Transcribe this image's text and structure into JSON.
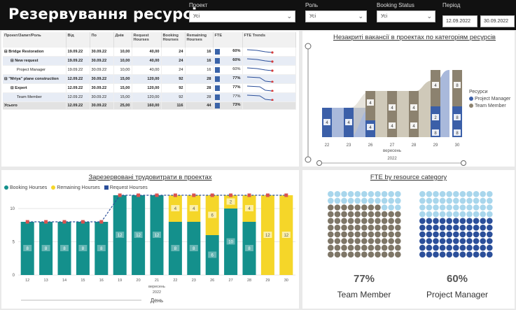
{
  "app": {
    "title": "Резервування ресурсів"
  },
  "filters": {
    "project": {
      "label": "Проект",
      "value": "Усі"
    },
    "role": {
      "label": "Роль",
      "value": "Усі"
    },
    "status": {
      "label": "Booking Status",
      "value": "Усі"
    },
    "period": {
      "label": "Період",
      "start": "12.09.2022",
      "end": "30.09.2022"
    }
  },
  "table": {
    "headers": [
      "Проект/Запит/Роль",
      "Від",
      "По",
      "Днів",
      "Request Hourses",
      "Booking Hourses",
      "Remaining Hourses",
      "FTE",
      "FTE Trends"
    ],
    "rows": [
      {
        "name": "Bridge Restoration",
        "from": "19.09.22",
        "to": "30.09.22",
        "days": "10,00",
        "req": "40,00",
        "book": "24",
        "rem": "16",
        "fte": "60%",
        "level": 0,
        "bold": true,
        "exp": "⊟"
      },
      {
        "name": "New request",
        "from": "19.09.22",
        "to": "30.09.22",
        "days": "10,00",
        "req": "40,00",
        "book": "24",
        "rem": "16",
        "fte": "60%",
        "level": 1,
        "bold": true,
        "exp": "⊟"
      },
      {
        "name": "Project Manager",
        "from": "19.09.22",
        "to": "30.09.22",
        "days": "10,00",
        "req": "40,00",
        "book": "24",
        "rem": "16",
        "fte": "60%",
        "level": 2,
        "bold": false,
        "exp": ""
      },
      {
        "name": "\"Mriya\" plane construction",
        "from": "12.09.22",
        "to": "30.09.22",
        "days": "15,00",
        "req": "120,00",
        "book": "92",
        "rem": "28",
        "fte": "77%",
        "level": 0,
        "bold": true,
        "exp": "⊟"
      },
      {
        "name": "Expert",
        "from": "12.09.22",
        "to": "30.09.22",
        "days": "15,00",
        "req": "120,00",
        "book": "92",
        "rem": "28",
        "fte": "77%",
        "level": 1,
        "bold": true,
        "exp": "⊟"
      },
      {
        "name": "Team Member",
        "from": "12.09.22",
        "to": "30.09.22",
        "days": "15,00",
        "req": "120,00",
        "book": "92",
        "rem": "28",
        "fte": "77%",
        "level": 2,
        "bold": false,
        "exp": ""
      }
    ],
    "total": {
      "name": "Усього",
      "from": "12.09.22",
      "to": "30.09.22",
      "days": "25,00",
      "req": "160,00",
      "book": "116",
      "rem": "44",
      "fte": "73%"
    }
  },
  "sankey": {
    "title": "Незакриті вакансії в проектах по категоріям ресурсів",
    "x_ticks": [
      "22",
      "23",
      "26",
      "27",
      "28",
      "29",
      "30"
    ],
    "x_sub": "вересень",
    "x_year": "2022",
    "legend_title": "Ресурси",
    "legend": [
      {
        "name": "Project Manager",
        "color": "#3b5fa8"
      },
      {
        "name": "Team Member",
        "color": "#8c826f"
      }
    ],
    "labels": [
      "4",
      "4",
      "4",
      "4",
      "4",
      "4",
      "4",
      "4",
      "4",
      "2",
      "8",
      "8",
      "8",
      "8"
    ],
    "colors": {
      "pm": "#3b5fa8",
      "tm": "#8c826f",
      "flow_pm": "#a9b9db",
      "flow_tm": "#cfc9b9"
    }
  },
  "chart_data": {
    "type": "bar",
    "title": "Зарезервовані трудовитрати в проектах",
    "categories": [
      "12",
      "13",
      "14",
      "15",
      "16",
      "19",
      "20",
      "21",
      "22",
      "23",
      "26",
      "27",
      "28",
      "29",
      "30"
    ],
    "x_sub": "вересень",
    "x_year": "2022",
    "xlabel": "День",
    "ylim": [
      0,
      12
    ],
    "y_ticks": [
      "0",
      "5",
      "10"
    ],
    "series": [
      {
        "name": "Booking Hourses",
        "color": "#14908c",
        "values": [
          8,
          8,
          8,
          8,
          8,
          12,
          12,
          12,
          8,
          8,
          6,
          10,
          8,
          0,
          0
        ]
      },
      {
        "name": "Remaining Hourses",
        "color": "#f5d629",
        "values": [
          0,
          0,
          0,
          0,
          0,
          0,
          0,
          0,
          4,
          4,
          6,
          2,
          4,
          12,
          12
        ]
      },
      {
        "name": "Request Hourses",
        "color": "#2b4f9a",
        "values": [
          8,
          8,
          8,
          8,
          8,
          12,
          12,
          12,
          12,
          12,
          12,
          12,
          12,
          12,
          12
        ]
      }
    ],
    "booking_labels": [
      "8",
      "8",
      "8",
      "8",
      "8",
      "12",
      "12",
      "12",
      "8",
      "8",
      "6",
      "10",
      "8",
      "",
      ""
    ],
    "remaining_labels": [
      "",
      "",
      "",
      "",
      "",
      "",
      "",
      "",
      "4",
      "4",
      "6",
      "2",
      "4",
      "12",
      "12"
    ]
  },
  "waffle": {
    "title": "FTE by resource category",
    "items": [
      {
        "category": "Team Member",
        "pct": "77%",
        "value": 77,
        "fill": "#7e7667",
        "empty": "#a8d6ec"
      },
      {
        "category": "Project Manager",
        "pct": "60%",
        "value": 60,
        "fill": "#2b4f9a",
        "empty": "#a8d6ec"
      }
    ]
  }
}
